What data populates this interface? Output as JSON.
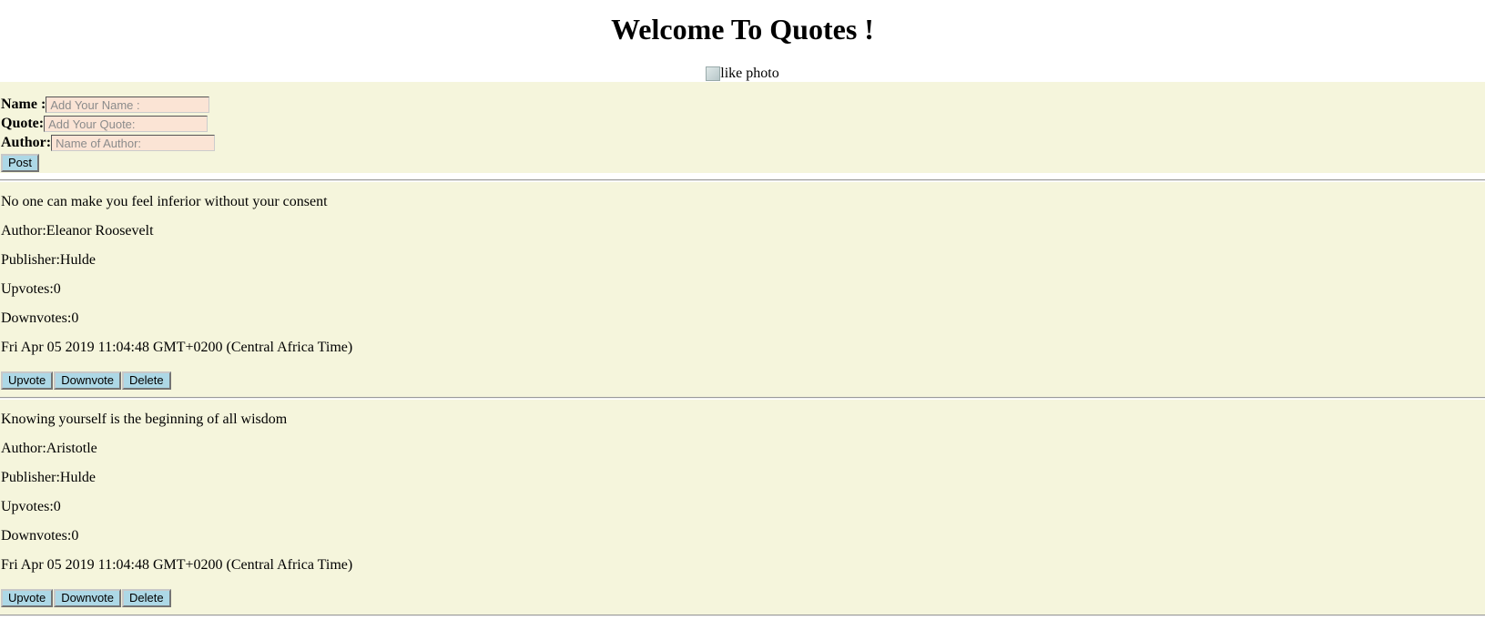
{
  "header": {
    "title": "Welcome To Quotes !",
    "photo_alt": "like photo"
  },
  "form": {
    "name_label": "Name :",
    "name_placeholder": "Add Your Name :",
    "quote_label": "Quote:",
    "quote_placeholder": "Add Your Quote:",
    "author_label": "Author:",
    "author_placeholder": "Name of Author:",
    "post_label": "Post"
  },
  "colors": {
    "form_background": "#f5f5dc",
    "input_background": "#fbe4d5",
    "button_background": "#add8e6"
  },
  "quotes": [
    {
      "text": "No one can make you feel inferior without your consent",
      "author": "Author:Eleanor Roosevelt",
      "publisher": "Publisher:Hulde",
      "upvotes": "Upvotes:0",
      "downvotes": "Downvotes:0",
      "date": "Fri Apr 05 2019 11:04:48 GMT+0200 (Central Africa Time)",
      "upvote_label": "Upvote",
      "downvote_label": "Downvote",
      "delete_label": "Delete"
    },
    {
      "text": "Knowing yourself is the beginning of all wisdom",
      "author": "Author:Aristotle",
      "publisher": "Publisher:Hulde",
      "upvotes": "Upvotes:0",
      "downvotes": "Downvotes:0",
      "date": "Fri Apr 05 2019 11:04:48 GMT+0200 (Central Africa Time)",
      "upvote_label": "Upvote",
      "downvote_label": "Downvote",
      "delete_label": "Delete"
    }
  ]
}
